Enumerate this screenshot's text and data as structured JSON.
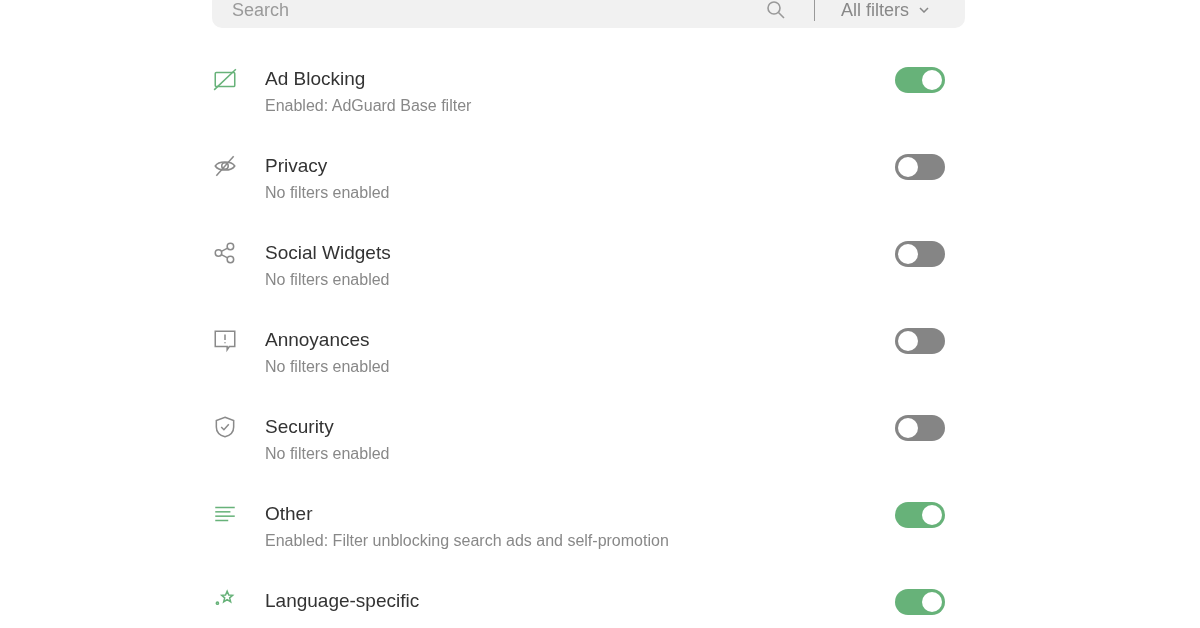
{
  "search": {
    "placeholder": "Search",
    "filter": "All filters"
  },
  "categories": [
    {
      "title": "Ad Blocking",
      "subtitle": "Enabled: AdGuard Base filter",
      "on": true
    },
    {
      "title": "Privacy",
      "subtitle": "No filters enabled",
      "on": false
    },
    {
      "title": "Social Widgets",
      "subtitle": "No filters enabled",
      "on": false
    },
    {
      "title": "Annoyances",
      "subtitle": "No filters enabled",
      "on": false
    },
    {
      "title": "Security",
      "subtitle": "No filters enabled",
      "on": false
    },
    {
      "title": "Other",
      "subtitle": "Enabled: Filter unblocking search ads and self-promotion",
      "on": true
    },
    {
      "title": "Language-specific",
      "on": true
    }
  ]
}
